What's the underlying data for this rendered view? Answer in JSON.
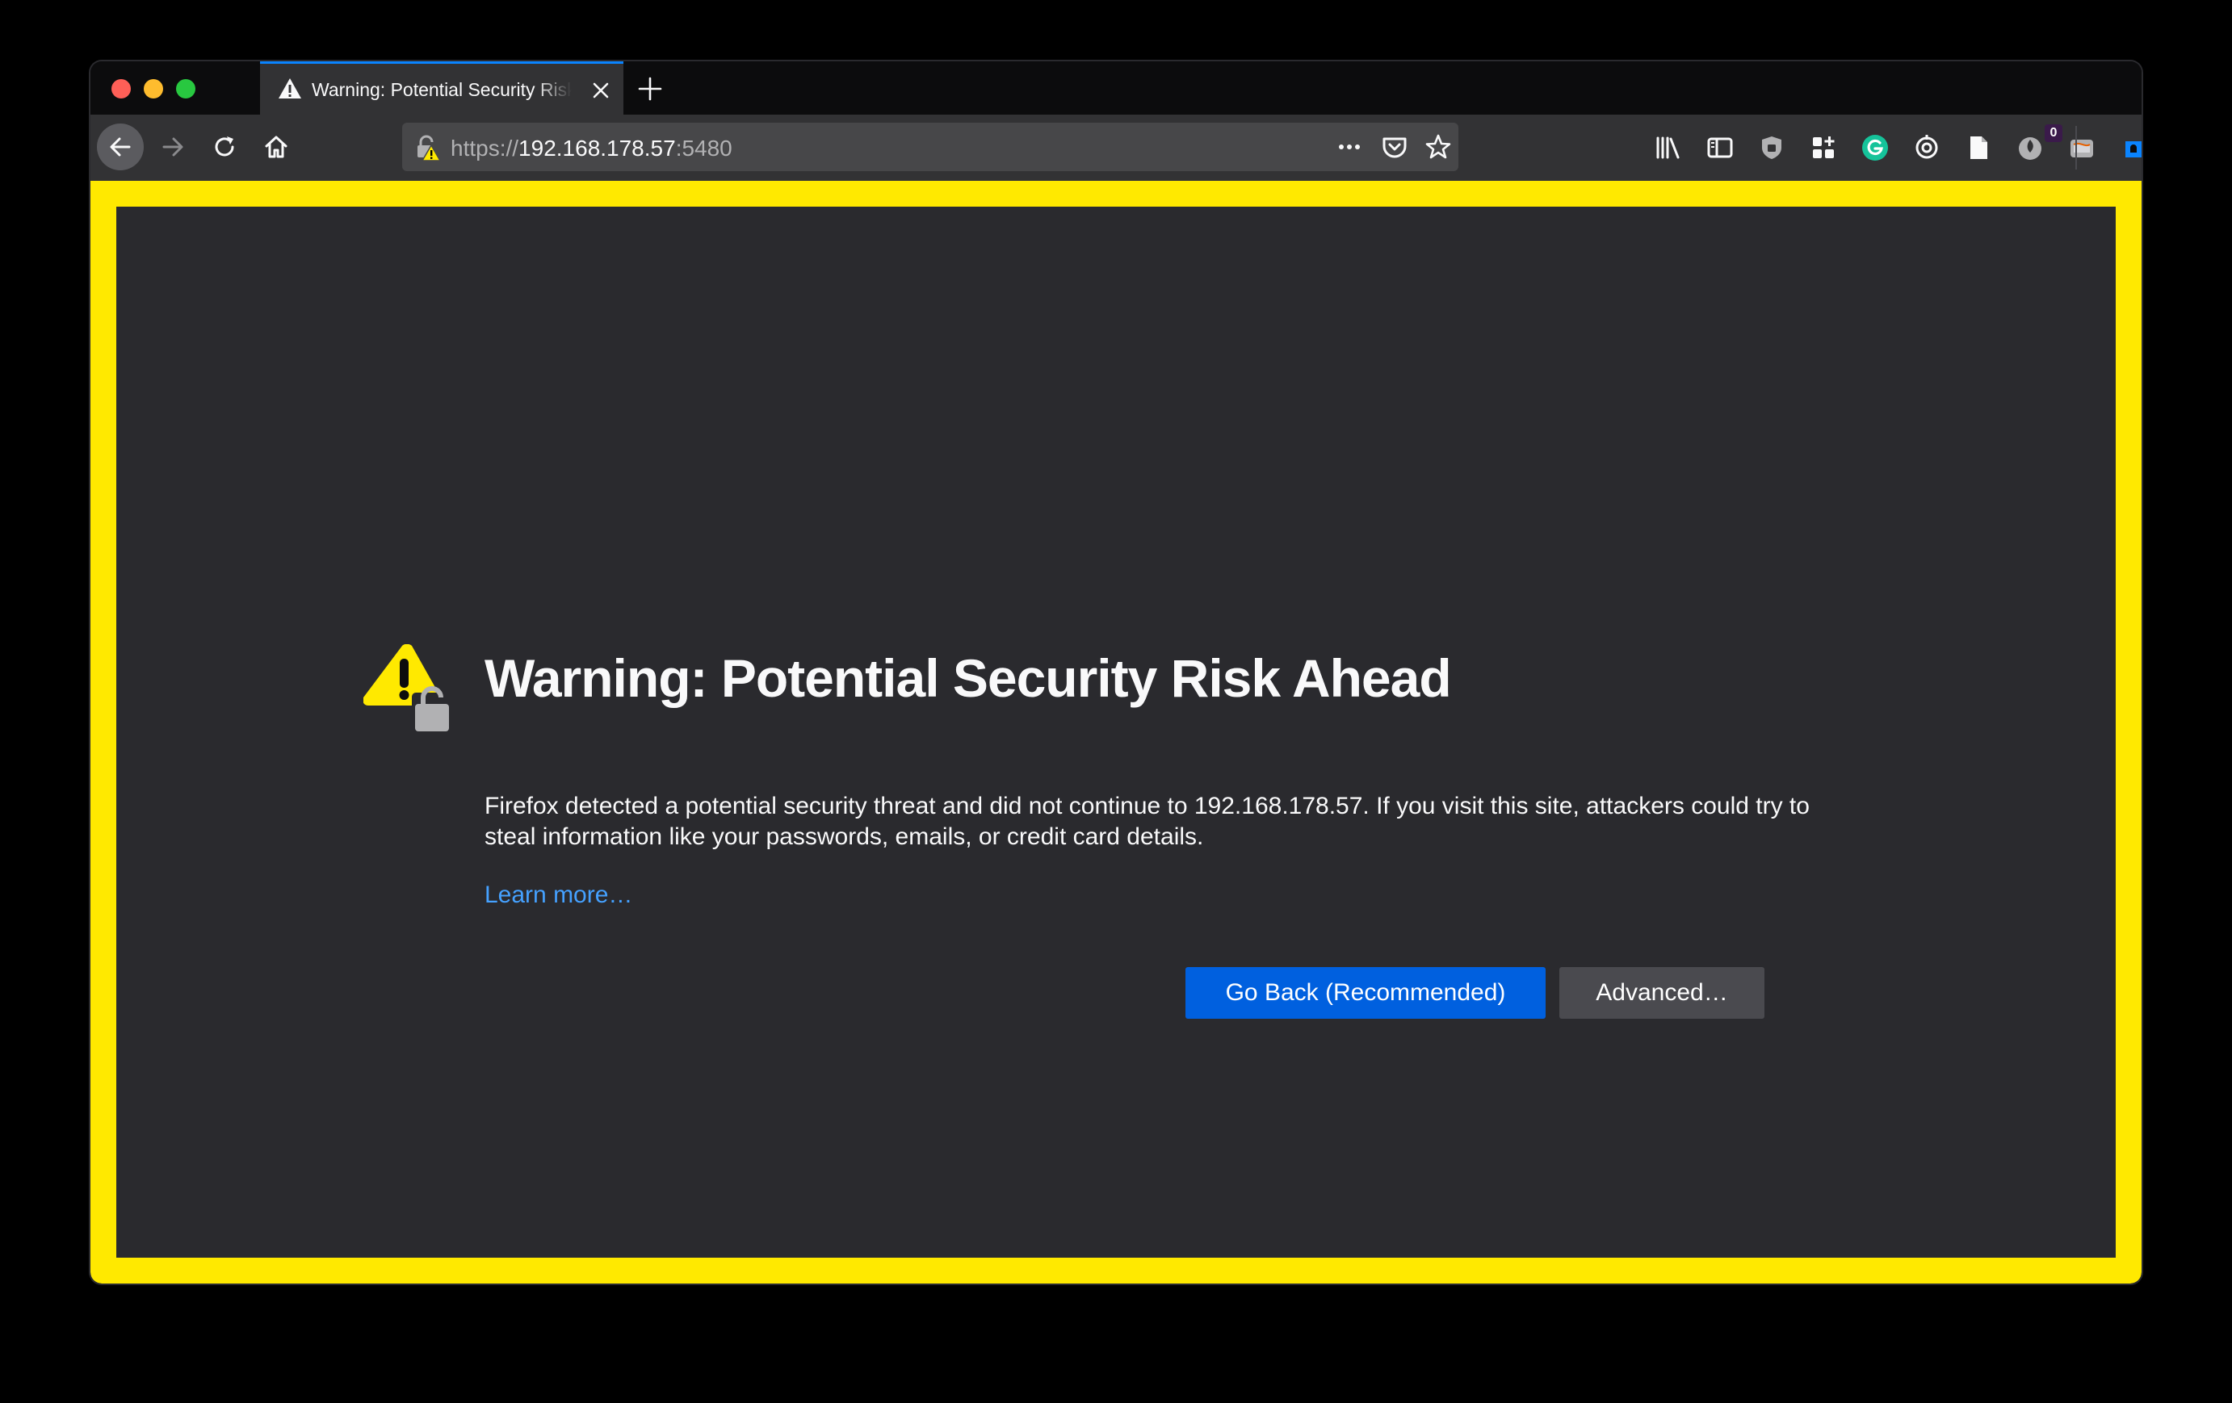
{
  "browser": {
    "tab": {
      "title": "Warning: Potential Security Risk Ahead"
    },
    "url": {
      "scheme": "https://",
      "host": "192.168.178.57",
      "port": ":5480"
    },
    "toolbar_badge": "0"
  },
  "error_page": {
    "title": "Warning: Potential Security Risk Ahead",
    "description": "Firefox detected a potential security threat and did not continue to 192.168.178.57. If you visit this site, attackers could try to steal information like your passwords, emails, or credit card details.",
    "learn_more": "Learn more…",
    "go_back_label": "Go Back (Recommended)",
    "advanced_label": "Advanced…"
  },
  "colors": {
    "highlight_border": "#ffe900",
    "page_background": "#2a2a2e",
    "primary_button": "#0060df",
    "link": "#45a1ff"
  }
}
